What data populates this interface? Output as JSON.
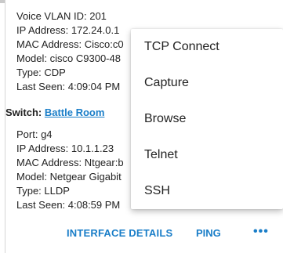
{
  "device1": {
    "voice_vlan": "Voice VLAN ID: 201",
    "ip": "IP Address: 172.24.0.1",
    "mac": "MAC Address: Cisco:c0",
    "model": "Model: cisco C9300-48",
    "type": "Type: CDP",
    "last_seen": "Last Seen: 4:09:04 PM"
  },
  "switch": {
    "label": "Switch:",
    "name": "Battle Room"
  },
  "device2": {
    "port": "Port: g4",
    "ip": "IP Address: 10.1.1.23",
    "mac": "MAC Address: Ntgear:b",
    "model": "Model: Netgear Gigabit",
    "type": "Type: LLDP",
    "last_seen": "Last Seen: 4:08:59 PM"
  },
  "footer": {
    "interface_details": "INTERFACE DETAILS",
    "ping": "PING",
    "more": "•••"
  },
  "menu": {
    "items": [
      "TCP Connect",
      "Capture",
      "Browse",
      "Telnet",
      "SSH"
    ]
  }
}
